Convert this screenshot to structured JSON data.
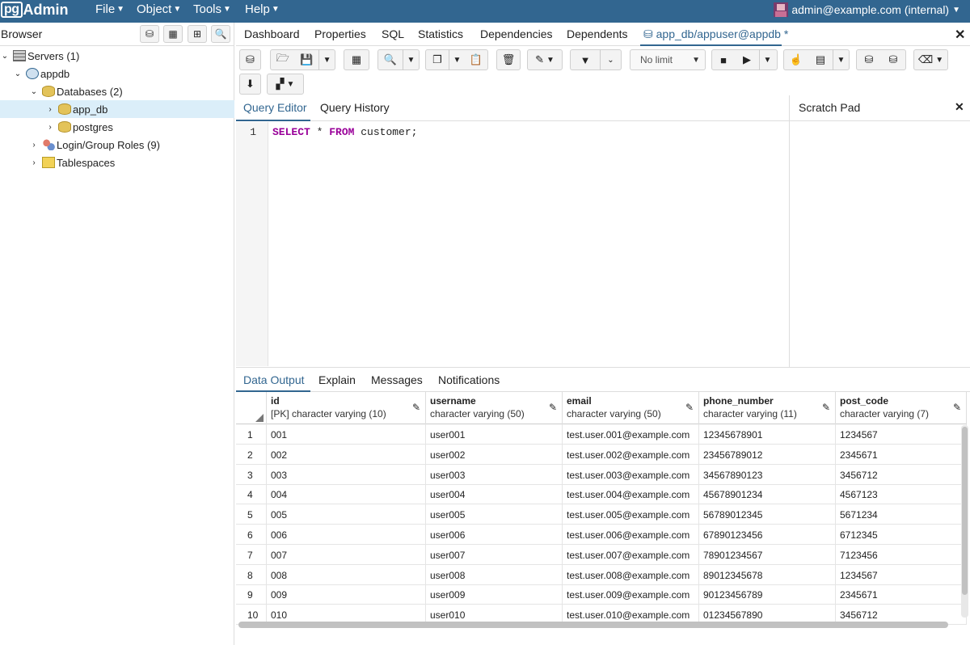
{
  "app": {
    "logo_pg": "pg",
    "logo_admin": "Admin"
  },
  "menu": [
    {
      "label": "File"
    },
    {
      "label": "Object"
    },
    {
      "label": "Tools"
    },
    {
      "label": "Help"
    }
  ],
  "user": {
    "label": "admin@example.com (internal)"
  },
  "browser": {
    "title": "Browser",
    "tree": [
      {
        "label": "Servers (1)",
        "icon": "servers-icon",
        "level": 0,
        "expanded": true
      },
      {
        "label": "appdb",
        "icon": "server-elephant-icon",
        "level": 1,
        "expanded": true
      },
      {
        "label": "Databases (2)",
        "icon": "databases-icon",
        "level": 2,
        "expanded": true
      },
      {
        "label": "app_db",
        "icon": "database-icon",
        "level": 3,
        "expanded": false,
        "selected": true
      },
      {
        "label": "postgres",
        "icon": "database-icon",
        "level": 3,
        "expanded": false
      },
      {
        "label": "Login/Group Roles (9)",
        "icon": "roles-icon",
        "level": 2,
        "expanded": false
      },
      {
        "label": "Tablespaces",
        "icon": "tablespaces-icon",
        "level": 2,
        "expanded": false
      }
    ]
  },
  "tabs": {
    "dashboard": "Dashboard",
    "properties": "Properties",
    "sql": "SQL",
    "statistics": "Statistics",
    "dependencies": "Dependencies",
    "dependents": "Dependents",
    "query_tool": "app_db/appuser@appdb *"
  },
  "toolbar": {
    "row_limit": "No limit"
  },
  "editor": {
    "tab_editor": "Query Editor",
    "tab_history": "Query History",
    "line_number": "1",
    "kw1": "SELECT",
    "star": " * ",
    "kw2": "FROM",
    "rest": " customer;",
    "scratch_title": "Scratch Pad"
  },
  "output": {
    "tabs": [
      "Data Output",
      "Explain",
      "Messages",
      "Notifications"
    ],
    "columns": [
      {
        "name": "id",
        "type": "[PK] character varying (10)"
      },
      {
        "name": "username",
        "type": "character varying (50)"
      },
      {
        "name": "email",
        "type": "character varying (50)"
      },
      {
        "name": "phone_number",
        "type": "character varying (11)"
      },
      {
        "name": "post_code",
        "type": "character varying (7)"
      }
    ],
    "rows": [
      [
        "1",
        "001",
        "user001",
        "test.user.001@example.com",
        "12345678901",
        "1234567"
      ],
      [
        "2",
        "002",
        "user002",
        "test.user.002@example.com",
        "23456789012",
        "2345671"
      ],
      [
        "3",
        "003",
        "user003",
        "test.user.003@example.com",
        "34567890123",
        "3456712"
      ],
      [
        "4",
        "004",
        "user004",
        "test.user.004@example.com",
        "45678901234",
        "4567123"
      ],
      [
        "5",
        "005",
        "user005",
        "test.user.005@example.com",
        "56789012345",
        "5671234"
      ],
      [
        "6",
        "006",
        "user006",
        "test.user.006@example.com",
        "67890123456",
        "6712345"
      ],
      [
        "7",
        "007",
        "user007",
        "test.user.007@example.com",
        "78901234567",
        "7123456"
      ],
      [
        "8",
        "008",
        "user008",
        "test.user.008@example.com",
        "89012345678",
        "1234567"
      ],
      [
        "9",
        "009",
        "user009",
        "test.user.009@example.com",
        "90123456789",
        "2345671"
      ],
      [
        "10",
        "010",
        "user010",
        "test.user.010@example.com",
        "01234567890",
        "3456712"
      ]
    ]
  }
}
